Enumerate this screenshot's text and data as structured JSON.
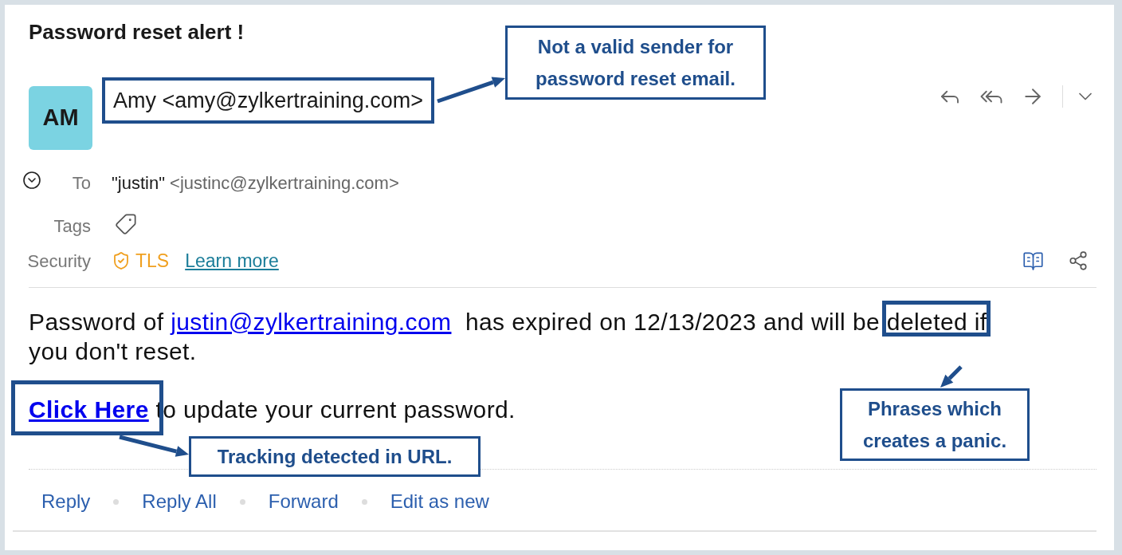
{
  "subject": "Password reset alert !",
  "sender": {
    "avatar": "AM",
    "address": "Amy <amy@zylkertraining.com>"
  },
  "recipient": {
    "label": "To",
    "name": "\"justin\"",
    "address": "<justinc@zylkertraining.com>"
  },
  "tags": {
    "label": "Tags"
  },
  "security": {
    "label": "Security",
    "protocol": "TLS",
    "link": "Learn more"
  },
  "body": {
    "before_link": "Password of ",
    "link": "justin@zylkertraining.com",
    "after_link": "  has expired on 12/13/2023 and will be ",
    "flagged_phrase": "deleted if",
    "rest": "you don't reset.",
    "action_link": "Click Here",
    "action_text": " to update your current password."
  },
  "actions": [
    {
      "label": "Reply"
    },
    {
      "label": "Reply All"
    },
    {
      "label": "Forward"
    },
    {
      "label": "Edit as new"
    }
  ],
  "callouts": [
    {
      "text": "Not a valid sender for password reset email."
    },
    {
      "text": "Tracking detected in URL."
    },
    {
      "text": "Phrases which creates a panic."
    }
  ]
}
